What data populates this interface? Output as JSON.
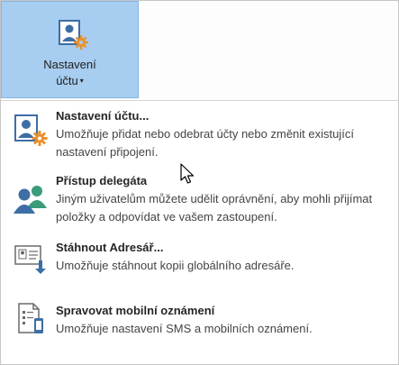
{
  "ribbon": {
    "button_line1": "Nastavení",
    "button_line2": "účtu",
    "caret": "▾",
    "button_icon": "account-settings-icon"
  },
  "menu": {
    "items": [
      {
        "title": "Nastavení účtu...",
        "description": "Umožňuje přidat nebo odebrat účty nebo změnit existující nastavení připojení.",
        "icon": "account-settings-icon"
      },
      {
        "title": "Přístup delegáta",
        "description": "Jiným uživatelům můžete udělit oprávnění, aby mohli přijímat položky a odpovídat ve vašem zastoupení.",
        "icon": "delegate-access-icon"
      },
      {
        "title": "Stáhnout Adresář...",
        "description": "Umožňuje stáhnout kopii globálního adresáře.",
        "icon": "download-address-book-icon"
      },
      {
        "title": "Spravovat mobilní oznámení",
        "description": "Umožňuje nastavení SMS a mobilních oznámení.",
        "icon": "mobile-notifications-icon"
      }
    ]
  },
  "colors": {
    "button_highlight": "#a7cdf0",
    "icon_blue": "#3d6ea5",
    "gear_orange": "#e8912c",
    "delegate_green": "#3a9c78"
  }
}
